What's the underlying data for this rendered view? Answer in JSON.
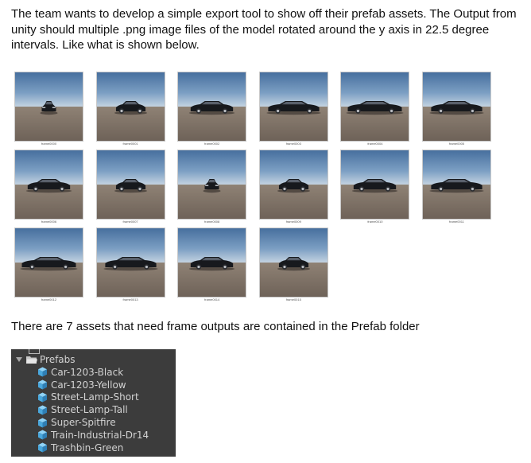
{
  "intro_text": "The team wants to develop a simple export tool to show off their prefab assets. The Output from unity should multiple .png image files of the model rotated around the y axis in 22.5 degree intervals. Like what is shown below.",
  "frames": [
    {
      "label": "frame0000",
      "angle": 0
    },
    {
      "label": "frame0001",
      "angle": 22.5
    },
    {
      "label": "frame0002",
      "angle": 45
    },
    {
      "label": "frame0003",
      "angle": 67.5
    },
    {
      "label": "frame0004",
      "angle": 90
    },
    {
      "label": "frame0005",
      "angle": 112.5
    },
    {
      "label": "frame0006",
      "angle": 135
    },
    {
      "label": "frame0007",
      "angle": 157.5
    },
    {
      "label": "frame0008",
      "angle": 180
    },
    {
      "label": "frame0009",
      "angle": 202.5
    },
    {
      "label": "frame0010",
      "angle": 225
    },
    {
      "label": "frame0011",
      "angle": 247.5
    },
    {
      "label": "frame0012",
      "angle": 270
    },
    {
      "label": "frame0013",
      "angle": 292.5
    },
    {
      "label": "frame0014",
      "angle": 315
    },
    {
      "label": "frame0015",
      "angle": 337.5
    }
  ],
  "statement_text": "There are 7 assets that need frame outputs are contained in the Prefab folder",
  "hierarchy": {
    "folder_label": "Prefabs",
    "items": [
      "Car-1203-Black",
      "Car-1203-Yellow",
      "Street-Lamp-Short",
      "Street-Lamp-Tall",
      "Super-Spitfire",
      "Train-Industrial-Dr14",
      "Trashbin-Green"
    ]
  },
  "colors": {
    "hierarchy_bg": "#3c3c3c",
    "hierarchy_text": "#d2d2d2",
    "sky_top": "#476f9e",
    "ground": "#7e7267",
    "prefab_icon": "#5fb8e8"
  },
  "icons": {
    "folder": "folder-open-icon",
    "prefab": "prefab-cube-icon",
    "expand": "triangle-down-icon"
  }
}
